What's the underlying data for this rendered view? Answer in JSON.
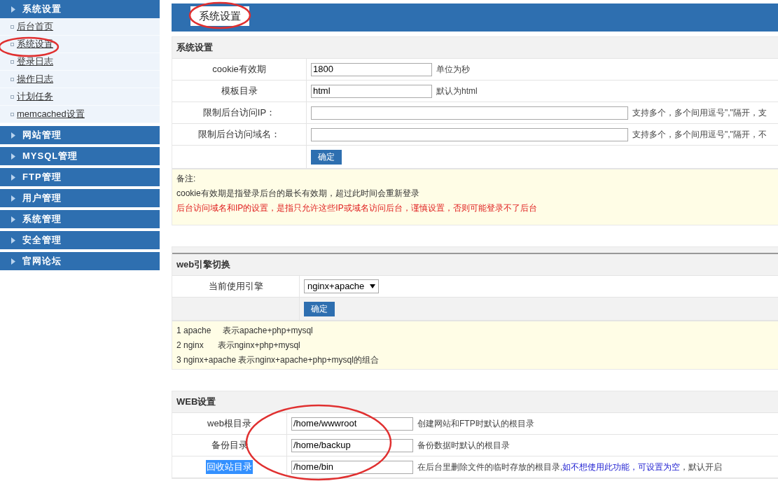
{
  "sidebar": {
    "groups": [
      {
        "label": "系统设置",
        "items": [
          {
            "label": "后台首页"
          },
          {
            "label": "系统设置"
          },
          {
            "label": "登录日志"
          },
          {
            "label": "操作日志"
          },
          {
            "label": "计划任务"
          },
          {
            "label": "memcached设置"
          }
        ]
      },
      {
        "label": "网站管理"
      },
      {
        "label": "MYSQL管理"
      },
      {
        "label": "FTP管理"
      },
      {
        "label": "用户管理"
      },
      {
        "label": "系统管理"
      },
      {
        "label": "安全管理"
      },
      {
        "label": "官网论坛"
      }
    ]
  },
  "tab": {
    "label": "系统设置"
  },
  "sections": [
    {
      "title": "系统设置",
      "rule": false,
      "rows": [
        {
          "kind": "input",
          "label": "cookie有效期",
          "value": "1800",
          "hint": [
            {
              "text": "单位为秒",
              "emphasis": false
            }
          ]
        },
        {
          "kind": "input",
          "label": "模板目录",
          "value": "html",
          "hint": [
            {
              "text": "默认为html",
              "emphasis": false
            }
          ]
        },
        {
          "kind": "wide-input",
          "label": "限制后台访问IP：",
          "hint": [
            {
              "text": "支持多个，多个间用逗号\",\"隔开，支",
              "emphasis": false
            }
          ]
        },
        {
          "kind": "wide-input",
          "label": "限制后台访问域名：",
          "hint": [
            {
              "text": "支持多个，多个间用逗号\",\"隔开，不",
              "emphasis": false
            }
          ]
        },
        {
          "kind": "button",
          "label": "确定"
        }
      ],
      "notes": [
        {
          "text": "备注:",
          "kind": "normal"
        },
        {
          "text": "cookie有效期是指登录后台的最长有效期，超过此时间会重新登录",
          "kind": "normal"
        },
        {
          "text": "后台访问域名和IP的设置，是指只允许这些IP或域名访问后台，谨慎设置，否则可能登录不了后台",
          "kind": "warning"
        }
      ]
    },
    {
      "title": "web引擎切换",
      "rule": true,
      "rows": [
        {
          "kind": "select",
          "label": "当前使用引擎",
          "value": "nginx+apache"
        },
        {
          "kind": "button",
          "label": "确定"
        }
      ],
      "notes": [
        {
          "text": "1 apache     表示apache+php+mysql",
          "kind": "normal"
        },
        {
          "text": "2 nginx      表示nginx+php+mysql",
          "kind": "normal"
        },
        {
          "text": "3 nginx+apache 表示nginx+apache+php+mysql的组合",
          "kind": "normal"
        }
      ]
    },
    {
      "title": "WEB设置",
      "rule": false,
      "rows": [
        {
          "kind": "input",
          "label": "web根目录",
          "value": "/home/wwwroot",
          "highlighted": false,
          "hint": [
            {
              "text": "创建网站和FTP时默认的根目录",
              "emphasis": false
            }
          ]
        },
        {
          "kind": "input",
          "label": "备份目录",
          "value": "/home/backup",
          "highlighted": false,
          "hint": [
            {
              "text": "备份数据时默认的根目录",
              "emphasis": false
            }
          ]
        },
        {
          "kind": "input",
          "label": "回收站目录",
          "value": "/home/bin",
          "highlighted": true,
          "hint": [
            {
              "text": "在后台里删除文件的临时存放的根目录,",
              "emphasis": false
            },
            {
              "text": "如不想使用此功能，可设置为空",
              "emphasis": true
            },
            {
              "text": "，默认开启",
              "emphasis": false
            }
          ]
        }
      ]
    }
  ]
}
